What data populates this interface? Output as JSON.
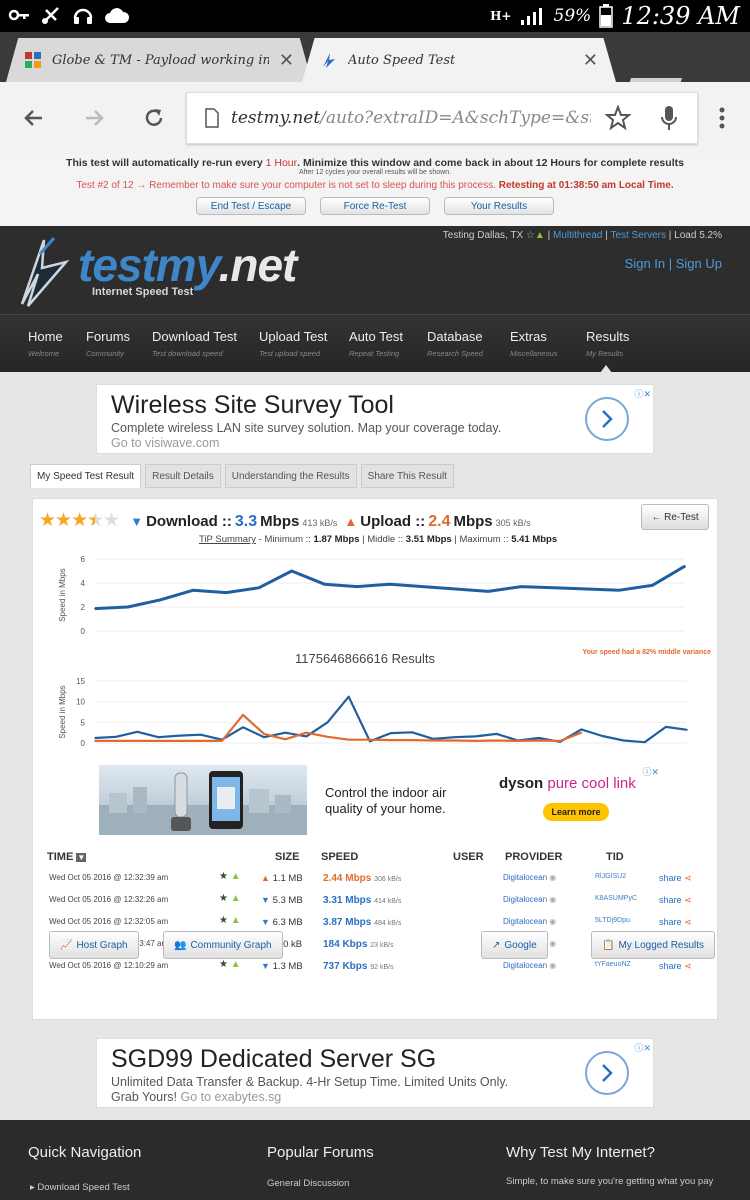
{
  "status_bar": {
    "network": "H+",
    "battery": "59%",
    "time": "12:39 AM"
  },
  "browser": {
    "tabs": [
      {
        "title": "Globe & TM - Payload working in defa",
        "active": false
      },
      {
        "title": "Auto Speed Test",
        "active": true
      }
    ],
    "url_host": "testmy.net",
    "url_path": "/auto?extraID=A&schType=&st=1&r_"
  },
  "retest_bar": {
    "line1_prefix": "This test will automatically re-run every",
    "line1_interval": "1 Hour",
    "line1_suffix": ". Minimize this window and come back in about 12 Hours for complete results",
    "line2": "After 12 cycles your overall results will be shown.",
    "line3_prefix": "Test #2 of 12 → Remember to make sure your computer is not set to sleep during this process.",
    "line3_retest": "Retesting at 01:38:50 am Local Time.",
    "buttons": [
      "End Test / Escape",
      "Force Re-Test",
      "Your Results"
    ]
  },
  "header": {
    "testing_location": "Testing Dallas, TX",
    "multithread": "Multithread",
    "test_servers": "Test Servers",
    "load": "Load 5.2%",
    "sign_in": "Sign In",
    "sign_up": "Sign Up",
    "logo_main": "testmy",
    "logo_dot": ".net",
    "logo_tagline": "Internet Speed Test"
  },
  "nav": [
    {
      "label": "Home",
      "sub": "Welcome"
    },
    {
      "label": "Forums",
      "sub": "Community"
    },
    {
      "label": "Download Test",
      "sub": "Test download speed"
    },
    {
      "label": "Upload Test",
      "sub": "Test upload speed"
    },
    {
      "label": "Auto Test",
      "sub": "Repeat Testing"
    },
    {
      "label": "Database",
      "sub": "Research Speed"
    },
    {
      "label": "Extras",
      "sub": "Miscellaneous"
    },
    {
      "label": "Results",
      "sub": "My Results"
    }
  ],
  "ad_top": {
    "title": "Wireless Site Survey Tool",
    "desc": "Complete wireless LAN site survey solution. Map your coverage today.",
    "source": "Go to visiwave.com"
  },
  "result_tabs": [
    "My Speed Test Result",
    "Result Details",
    "Understanding the Results",
    "Share This Result"
  ],
  "summary": {
    "download_label": "Download ::",
    "download_value": "3.3",
    "download_unit": "Mbps",
    "download_kb": "413 kB/s",
    "upload_label": "Upload ::",
    "upload_value": "2.4",
    "upload_unit": "Mbps",
    "upload_kb": "305 kB/s",
    "retest_button": "← Re-Test",
    "tip_label": "TiP Summary",
    "tip_min_label": "- Minimum ::",
    "tip_min": "1.87 Mbps",
    "tip_mid_label": "| Middle ::",
    "tip_mid": "3.51 Mbps",
    "tip_max_label": "| Maximum ::",
    "tip_max": "5.41 Mbps",
    "stars_filled": 3.5,
    "stars_total": 5
  },
  "chart_data": [
    {
      "type": "line",
      "ylabel": "Speed in Mbps",
      "ylim": [
        0,
        6
      ],
      "yticks": [
        "6",
        "4",
        "2",
        "0"
      ],
      "series": [
        {
          "color": "#1f5f9f",
          "values": [
            1.87,
            2.0,
            2.6,
            3.4,
            3.2,
            3.6,
            5.0,
            3.9,
            3.7,
            3.9,
            3.7,
            3.5,
            3.3,
            3.7,
            3.6,
            3.5,
            3.4,
            3.8,
            5.41
          ]
        }
      ]
    },
    {
      "type": "line",
      "title": "1175646866616 Results",
      "ylabel": "Speed in Mbps",
      "ylim": [
        0,
        15
      ],
      "yticks": [
        "15",
        "10",
        "5",
        "0"
      ],
      "annotation": "Your speed had a 82% middle variance",
      "series": [
        {
          "color": "#1f5f9f",
          "values": [
            1.2,
            1.5,
            2.7,
            1.4,
            1.8,
            2.0,
            0.8,
            3.8,
            1.4,
            2.5,
            1.6,
            5.0,
            11.2,
            0.4,
            2.4,
            2.6,
            1.0,
            1.4,
            1.6,
            2.2,
            0.6,
            1.2,
            0.3,
            3.3,
            1.7,
            0.6,
            0.2,
            3.9,
            3.2
          ]
        },
        {
          "color": "#e06a2f",
          "values": [
            0.5,
            0.5,
            0.5,
            0.5,
            0.5,
            0.5,
            0.5,
            6.8,
            2.2,
            0.9,
            2.5,
            1.5,
            0.8,
            0.8,
            0.7,
            0.7,
            0.6,
            0.6,
            0.5,
            0.6,
            0.5,
            0.6,
            0.5,
            2.5
          ]
        }
      ]
    }
  ],
  "dyson_ad": {
    "text": "Control the indoor air quality of your home.",
    "brand": "dyson",
    "product": "pure cool link",
    "cta": "Learn more"
  },
  "table": {
    "headers": [
      "TIME",
      "SIZE",
      "SPEED",
      "USER",
      "PROVIDER",
      "TID"
    ],
    "rows": [
      {
        "time": "Wed Oct 05 2016 @ 12:32:39 am",
        "size": "1.1 MB",
        "speed": "2.44 Mbps",
        "kb": "306 kB/s",
        "dir": "up",
        "provider": "Digitalocean",
        "tid": "RlJGISU2",
        "share": "share"
      },
      {
        "time": "Wed Oct 05 2016 @ 12:32:26 am",
        "size": "5.3 MB",
        "speed": "3.31 Mbps",
        "kb": "414 kB/s",
        "dir": "down",
        "provider": "Digitalocean",
        "tid": "K8ASUMPyC",
        "share": "share"
      },
      {
        "time": "Wed Oct 05 2016 @ 12:32:05 am",
        "size": "6.3 MB",
        "speed": "3.87 Mbps",
        "kb": "484 kB/s",
        "dir": "down",
        "provider": "Digitalocean",
        "tid": "5LTDj9Dpu",
        "share": "share"
      },
      {
        "time": "Wed Oct 05 2016 @ 12:13:47 am",
        "size": "560 kB",
        "speed": "184 Kbps",
        "kb": "23 kB/s",
        "dir": "down",
        "provider": "Digitalocean",
        "tid": "yOEVTMd1Y",
        "share": "share"
      },
      {
        "time": "Wed Oct 05 2016 @ 12:10:29 am",
        "size": "1.3 MB",
        "speed": "737 Kbps",
        "kb": "92 kB/s",
        "dir": "down",
        "provider": "Digitalocean",
        "tid": "tYFaeuoNZ",
        "share": "share"
      }
    ]
  },
  "graph_buttons": [
    "Host Graph",
    "Community Graph",
    "Google",
    "My Logged Results"
  ],
  "ad_bottom": {
    "title": "SGD99 Dedicated Server SG",
    "desc": "Unlimited Data Transfer & Backup. 4-Hr Setup Time. Limited Units Only.",
    "desc2": "Grab Yours!",
    "source": "Go to exabytes.sg"
  },
  "footer": {
    "col1_title": "Quick Navigation",
    "col1_item": "Download Speed Test",
    "col2_title": "Popular Forums",
    "col2_item": "General Discussion",
    "col3_title": "Why Test My Internet?",
    "col3_text": "Simple, to make sure you're getting what you pay"
  }
}
